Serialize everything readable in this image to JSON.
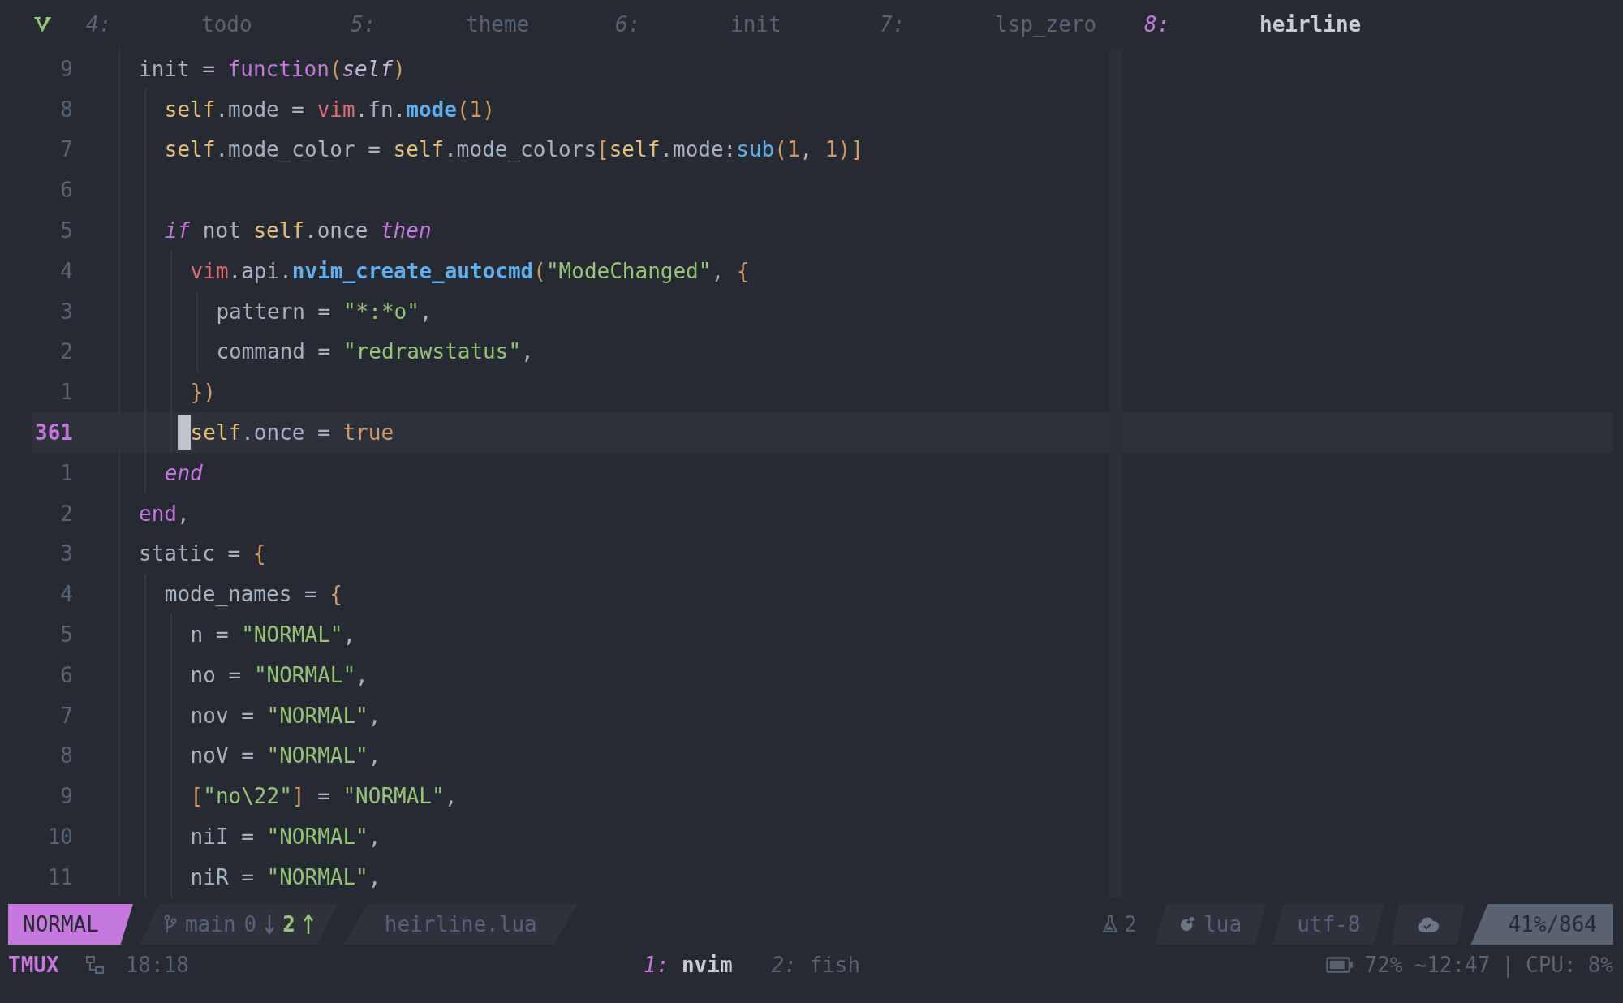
{
  "tabline": {
    "tabs": [
      {
        "number": "4:",
        "label": "todo",
        "selected": false
      },
      {
        "number": "5:",
        "label": "theme",
        "selected": false
      },
      {
        "number": "6:",
        "label": "init",
        "selected": false
      },
      {
        "number": "7:",
        "label": "lsp_zero",
        "selected": false
      },
      {
        "number": "8:",
        "label": "heirline",
        "selected": true
      }
    ]
  },
  "editor": {
    "lines": [
      {
        "number": "9",
        "current": false,
        "tokens": [
          {
            "text": "init = ",
            "kind": "plain"
          },
          {
            "text": "function",
            "kind": "keyword"
          },
          {
            "text": "(",
            "kind": "bracket"
          },
          {
            "text": "self",
            "kind": "param"
          },
          {
            "text": ")",
            "kind": "bracket"
          }
        ]
      },
      {
        "number": "8",
        "current": false,
        "tokens": [
          {
            "text": "  self",
            "kind": "self"
          },
          {
            "text": ".mode = ",
            "kind": "plain"
          },
          {
            "text": "vim",
            "kind": "variable"
          },
          {
            "text": ".fn.",
            "kind": "plain"
          },
          {
            "text": "mode",
            "kind": "function"
          },
          {
            "text": "(",
            "kind": "bracket"
          },
          {
            "text": "1",
            "kind": "number"
          },
          {
            "text": ")",
            "kind": "bracket"
          }
        ]
      },
      {
        "number": "7",
        "current": false,
        "tokens": [
          {
            "text": "  self",
            "kind": "self"
          },
          {
            "text": ".mode_color = ",
            "kind": "plain"
          },
          {
            "text": "self",
            "kind": "self"
          },
          {
            "text": ".mode_colors",
            "kind": "plain"
          },
          {
            "text": "[",
            "kind": "bracket"
          },
          {
            "text": "self",
            "kind": "self"
          },
          {
            "text": ".mode:",
            "kind": "plain"
          },
          {
            "text": "sub",
            "kind": "method"
          },
          {
            "text": "(",
            "kind": "bracket"
          },
          {
            "text": "1",
            "kind": "number"
          },
          {
            "text": ", ",
            "kind": "plain"
          },
          {
            "text": "1",
            "kind": "number"
          },
          {
            "text": ")]",
            "kind": "bracket"
          }
        ]
      },
      {
        "number": "6",
        "current": false
      },
      {
        "number": "5",
        "current": false,
        "tokens": [
          {
            "text": "  if",
            "kind": "keyword_italic"
          },
          {
            "text": " not ",
            "kind": "plain"
          },
          {
            "text": "self",
            "kind": "self"
          },
          {
            "text": ".once ",
            "kind": "plain"
          },
          {
            "text": "then",
            "kind": "keyword_italic"
          }
        ]
      },
      {
        "number": "4",
        "current": false,
        "tokens": [
          {
            "text": "    vim",
            "kind": "variable"
          },
          {
            "text": ".api.",
            "kind": "plain"
          },
          {
            "text": "nvim_create_autocmd",
            "kind": "function"
          },
          {
            "text": "(",
            "kind": "bracket"
          },
          {
            "text": "\"ModeChanged\"",
            "kind": "string"
          },
          {
            "text": ", ",
            "kind": "plain"
          },
          {
            "text": "{",
            "kind": "bracket"
          }
        ]
      },
      {
        "number": "3",
        "current": false,
        "tokens": [
          {
            "text": "      pattern = ",
            "kind": "plain"
          },
          {
            "text": "\"*:*o\"",
            "kind": "string"
          },
          {
            "text": ",",
            "kind": "plain"
          }
        ]
      },
      {
        "number": "2",
        "current": false,
        "tokens": [
          {
            "text": "      command = ",
            "kind": "plain"
          },
          {
            "text": "\"redrawstatus\"",
            "kind": "string"
          },
          {
            "text": ",",
            "kind": "plain"
          }
        ]
      },
      {
        "number": "1",
        "current": false,
        "tokens": [
          {
            "text": "    })",
            "kind": "bracket"
          }
        ]
      },
      {
        "number": "361",
        "current": true,
        "tokens": [
          {
            "text": "    self",
            "kind": "self"
          },
          {
            "text": ".once = ",
            "kind": "plain"
          },
          {
            "text": "true",
            "kind": "number"
          }
        ]
      },
      {
        "number": "1",
        "current": false,
        "tokens": [
          {
            "text": "  end",
            "kind": "keyword_italic"
          }
        ]
      },
      {
        "number": "2",
        "current": false,
        "tokens": [
          {
            "text": "end",
            "kind": "keyword"
          },
          {
            "text": ",",
            "kind": "plain"
          }
        ]
      },
      {
        "number": "3",
        "current": false,
        "tokens": [
          {
            "text": "static = ",
            "kind": "plain"
          },
          {
            "text": "{",
            "kind": "bracket"
          }
        ]
      },
      {
        "number": "4",
        "current": false,
        "tokens": [
          {
            "text": "  mode_names = ",
            "kind": "plain"
          },
          {
            "text": "{",
            "kind": "bracket"
          }
        ]
      },
      {
        "number": "5",
        "current": false,
        "tokens": [
          {
            "text": "    n = ",
            "kind": "plain"
          },
          {
            "text": "\"NORMAL\"",
            "kind": "string"
          },
          {
            "text": ",",
            "kind": "plain"
          }
        ]
      },
      {
        "number": "6",
        "current": false,
        "tokens": [
          {
            "text": "    no = ",
            "kind": "plain"
          },
          {
            "text": "\"NORMAL\"",
            "kind": "string"
          },
          {
            "text": ",",
            "kind": "plain"
          }
        ]
      },
      {
        "number": "7",
        "current": false,
        "tokens": [
          {
            "text": "    nov = ",
            "kind": "plain"
          },
          {
            "text": "\"NORMAL\"",
            "kind": "string"
          },
          {
            "text": ",",
            "kind": "plain"
          }
        ]
      },
      {
        "number": "8",
        "current": false,
        "tokens": [
          {
            "text": "    noV = ",
            "kind": "plain"
          },
          {
            "text": "\"NORMAL\"",
            "kind": "string"
          },
          {
            "text": ",",
            "kind": "plain"
          }
        ]
      },
      {
        "number": "9",
        "current": false,
        "tokens": [
          {
            "text": "    [",
            "kind": "bracket"
          },
          {
            "text": "\"no\\22\"",
            "kind": "string"
          },
          {
            "text": "]",
            "kind": "bracket"
          },
          {
            "text": " = ",
            "kind": "plain"
          },
          {
            "text": "\"NORMAL\"",
            "kind": "string"
          },
          {
            "text": ",",
            "kind": "plain"
          }
        ]
      },
      {
        "number": "10",
        "current": false,
        "tokens": [
          {
            "text": "    niI = ",
            "kind": "plain"
          },
          {
            "text": "\"NORMAL\"",
            "kind": "string"
          },
          {
            "text": ",",
            "kind": "plain"
          }
        ]
      },
      {
        "number": "11",
        "current": false,
        "tokens": [
          {
            "text": "    niR = ",
            "kind": "plain"
          },
          {
            "text": "\"NORMAL\"",
            "kind": "string"
          },
          {
            "text": ",",
            "kind": "plain"
          }
        ]
      }
    ]
  },
  "statusline": {
    "mode": "NORMAL",
    "branch": "main",
    "behind": "0",
    "ahead": "2",
    "file": "heirline.lua",
    "diagnostics": "2",
    "filetype": "lua",
    "encoding": "utf-8",
    "position": "41%/864"
  },
  "tmux": {
    "session": "TMUX",
    "time": "18:18",
    "windows": [
      {
        "number": "1:",
        "name": "nvim",
        "selected": true
      },
      {
        "number": "2:",
        "name": "fish",
        "selected": false
      }
    ],
    "battery": "72%",
    "remaining": "~12:47",
    "separator": "|",
    "cpu_label": "CPU:",
    "cpu": "8%"
  }
}
